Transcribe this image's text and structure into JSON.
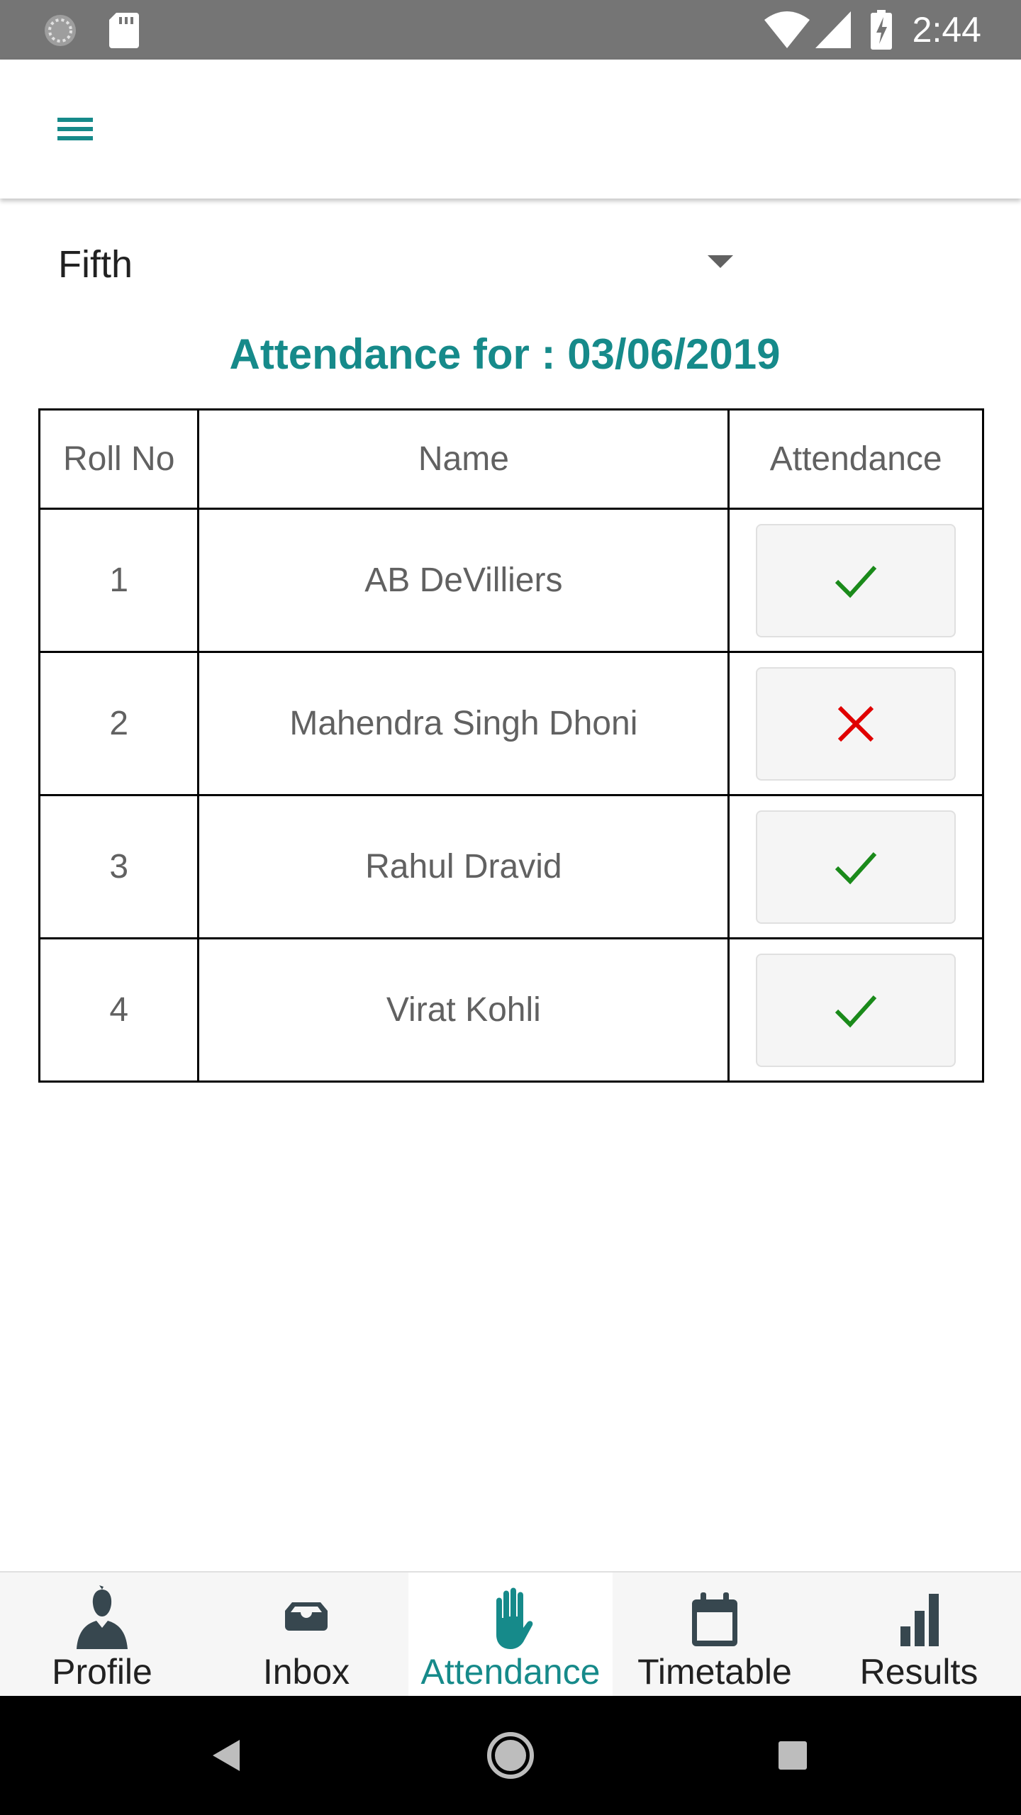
{
  "status_bar": {
    "time": "2:44",
    "icons": [
      "sync-icon",
      "sd-card-icon",
      "wifi-icon",
      "signal-icon",
      "battery-charging-icon"
    ]
  },
  "app_bar": {
    "menu_icon": "menu-icon"
  },
  "class_select": {
    "value": "Fifth"
  },
  "heading": {
    "text": "Attendance for : 03/06/2019",
    "color": "#168a8a"
  },
  "table": {
    "headers": {
      "roll": "Roll No",
      "name": "Name",
      "attendance": "Attendance"
    },
    "rows": [
      {
        "roll": "1",
        "name": "AB DeVilliers",
        "present": true
      },
      {
        "roll": "2",
        "name": "Mahendra Singh Dhoni",
        "present": false
      },
      {
        "roll": "3",
        "name": "Rahul Dravid",
        "present": true
      },
      {
        "roll": "4",
        "name": "Virat Kohli",
        "present": true
      }
    ]
  },
  "bottom_nav": {
    "items": [
      {
        "label": "Profile",
        "icon": "person-icon",
        "active": false
      },
      {
        "label": "Inbox",
        "icon": "inbox-icon",
        "active": false
      },
      {
        "label": "Attendance",
        "icon": "hand-icon",
        "active": true
      },
      {
        "label": "Timetable",
        "icon": "calendar-icon",
        "active": false
      },
      {
        "label": "Results",
        "icon": "bar-chart-icon",
        "active": false
      }
    ]
  },
  "colors": {
    "accent": "#168a8a",
    "present": "#1a8a1a",
    "absent": "#e00000",
    "icon_dark": "#37474f"
  }
}
